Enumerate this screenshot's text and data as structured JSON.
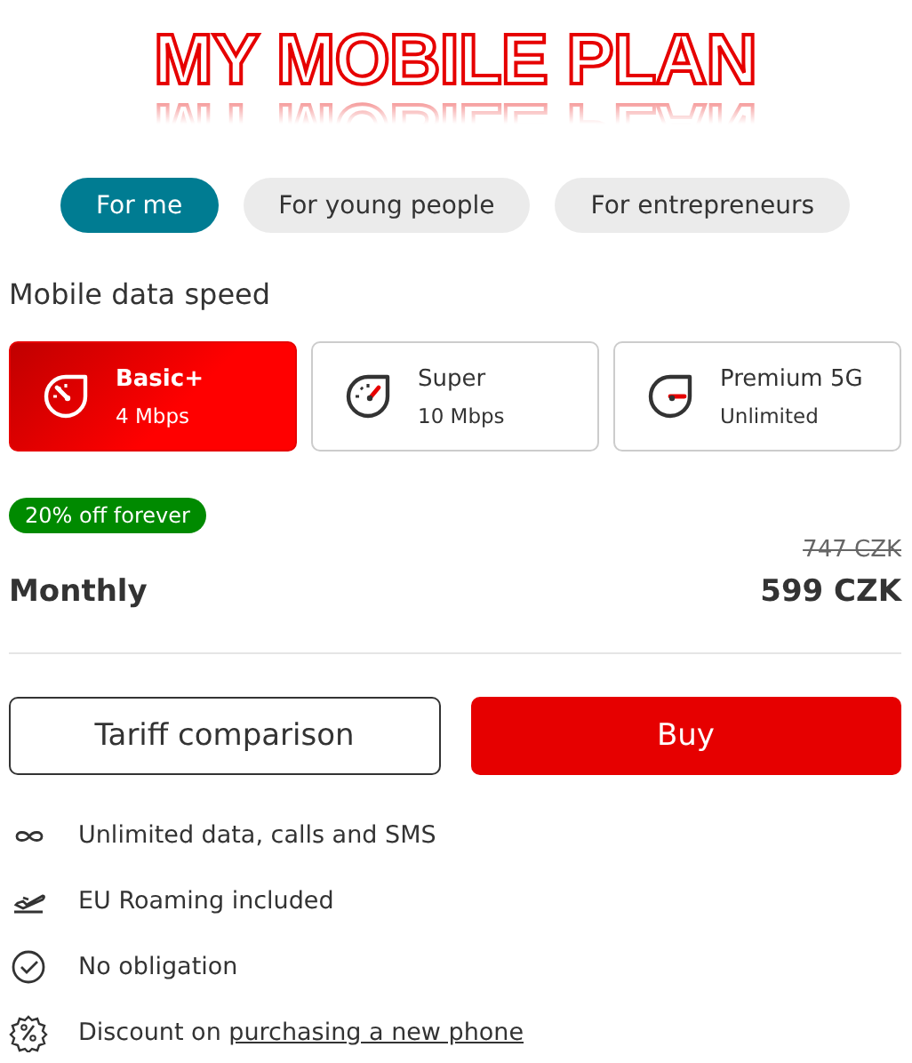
{
  "title": "MY MOBILE PLAN",
  "tabs": [
    {
      "label": "For me",
      "selected": true
    },
    {
      "label": "For young people",
      "selected": false
    },
    {
      "label": "For entrepreneurs",
      "selected": false
    }
  ],
  "section_title": "Mobile data speed",
  "plans": [
    {
      "name": "Basic+",
      "speed": "4 Mbps",
      "selected": true,
      "kind": "low"
    },
    {
      "name": "Super",
      "speed": "10 Mbps",
      "selected": false,
      "kind": "mid"
    },
    {
      "name": "Premium 5G",
      "speed": "Unlimited",
      "selected": false,
      "kind": "max"
    }
  ],
  "price": {
    "badge": "20% off forever",
    "label": "Monthly",
    "old_price": "747 CZK",
    "new_price": "599 CZK"
  },
  "buttons": [
    {
      "label": "Tariff comparison",
      "kind": "secondary"
    },
    {
      "label": "Buy",
      "kind": "primary"
    }
  ],
  "features": [
    {
      "kind": "infinity",
      "text": "Unlimited data, calls and SMS"
    },
    {
      "kind": "plane",
      "text": "EU Roaming included"
    },
    {
      "kind": "check",
      "text": "No obligation"
    },
    {
      "kind": "percent",
      "text": "Discount on ",
      "link": "purchasing a new phone"
    }
  ]
}
